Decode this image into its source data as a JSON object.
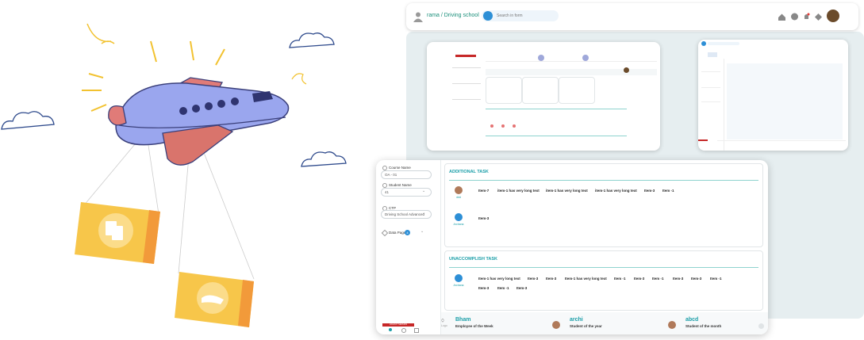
{
  "topbar": {
    "title": "rama / Driving school",
    "search_placeholder": "Search in form"
  },
  "sidebar": {
    "course_name_label": "Course Name",
    "course_name_value": "OA - 01",
    "student_name_label": "Student Name",
    "student_name_value": "41",
    "ctp_label": "CTP",
    "ctp_value": "Driving School Advanced",
    "data_page_label": "Data Page",
    "data_page_count": "4",
    "logout_button": "LOGOUT SESSION"
  },
  "additional_task": {
    "title": "ADDITIONAL TASK",
    "rows": [
      {
        "person": "ddd",
        "items": [
          "Item-7",
          "item-1 has very long text",
          "item-1 has very long text",
          "item-1 has very long text",
          "Item-3",
          "Item -1"
        ]
      },
      {
        "person": "Archana",
        "items": [
          "Item-3"
        ]
      }
    ]
  },
  "unaccomplish_task": {
    "title": "UNACCOMPLISH TASK",
    "rows": [
      {
        "person": "Archana",
        "items": [
          "Item-1 has very long text",
          "Item-3",
          "Item-3",
          "Item-1 has very long text",
          "Item -1",
          "Item-3",
          "Item -1",
          "Item-3",
          "Item-3",
          "Item -1",
          "Item-3",
          "Item -1",
          "Item-3"
        ]
      }
    ]
  },
  "honors": [
    {
      "name": "Bham",
      "role": "Employee of the Week"
    },
    {
      "name": "archi",
      "role": "Student of the year"
    },
    {
      "name": "abcd",
      "role": "Student of the month"
    }
  ],
  "footer_logo": "Logo",
  "colors": {
    "accent": "#1a9ea8",
    "brand_green": "#1a8f7a",
    "logout_red": "#c62828",
    "plane": "#9aa6ee",
    "box": "#f7c64a"
  }
}
